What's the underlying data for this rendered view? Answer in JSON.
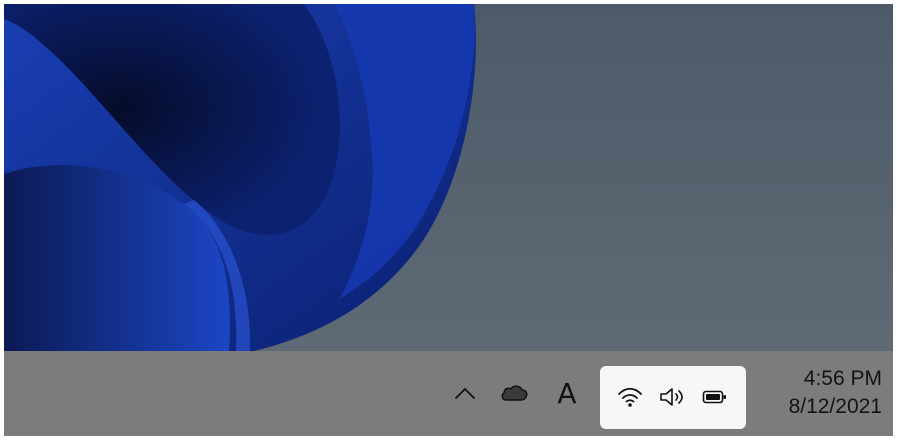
{
  "taskbar": {
    "tray_icons": [
      {
        "name": "chevron-up-icon",
        "label": "Show hidden icons"
      },
      {
        "name": "onedrive-cloud-icon",
        "label": "OneDrive"
      },
      {
        "name": "ime-indicator",
        "label": "A"
      }
    ],
    "status_group": [
      {
        "name": "wifi-icon"
      },
      {
        "name": "speaker-icon"
      },
      {
        "name": "battery-icon"
      }
    ],
    "clock": {
      "time": "4:56 PM",
      "date": "8/12/2021"
    }
  },
  "colors": {
    "desktop_background": "#56636f",
    "wallpaper_bloom": "#0f2a8a",
    "taskbar": "#7c7c7c",
    "status_group_background": "#f7f7f7"
  }
}
